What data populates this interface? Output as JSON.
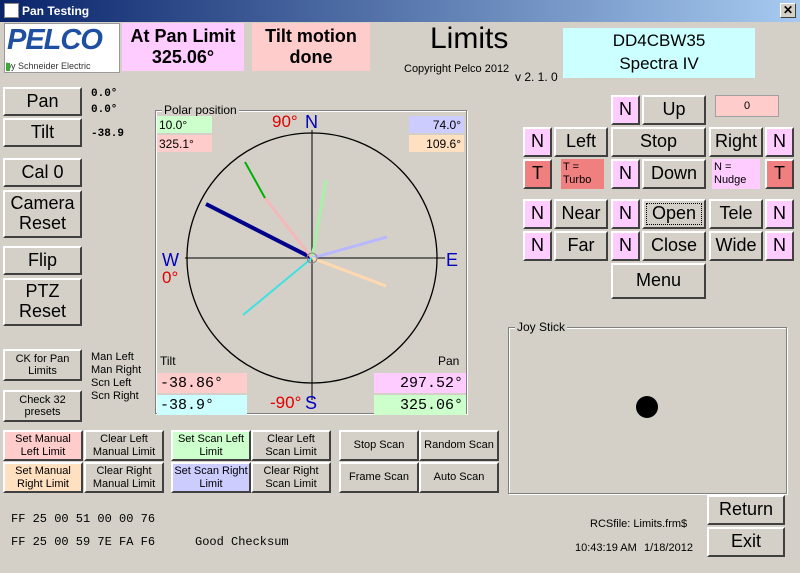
{
  "window": {
    "title": "Pan Testing",
    "close": "✕"
  },
  "logo": {
    "brand": "PELCO",
    "sub": "by Schneider Electric"
  },
  "status": {
    "pan_limit_label": "At Pan Limit",
    "pan_limit_value": "325.06°",
    "tilt_line1": "Tilt motion",
    "tilt_line2": "done"
  },
  "heading": {
    "title": "Limits",
    "copyright": "Copyright Pelco 2012",
    "version": "v 2. 1. 0"
  },
  "device": {
    "id": "DD4CBW35",
    "model": "Spectra IV"
  },
  "left_buttons": {
    "pan": "Pan",
    "tilt": "Tilt",
    "cal0": "Cal 0",
    "camera_reset": "Camera Reset",
    "flip": "Flip",
    "ptz_reset": "PTZ Reset",
    "ck_pan": "CK for Pan Limits",
    "check32": "Check 32 presets"
  },
  "readouts": {
    "pan1": "0.0°",
    "pan2": "0.0°",
    "tilt": "-38.9"
  },
  "limit_labels": [
    "Man Left",
    "Man Right",
    "Scn Left",
    "Scn Right"
  ],
  "polar": {
    "caption": "Polar position",
    "deg90": "90°",
    "N": "N",
    "E": "E",
    "W": "W",
    "S": "S",
    "deg0": "0°",
    "degm90": "-90°",
    "tl1": "10.0°",
    "tl2": "325.1°",
    "tr1": "74.0°",
    "tr2": "109.6°",
    "tilt_label": "Tilt",
    "pan_label": "Pan",
    "tilt1": "-38.86°",
    "tilt2": "-38.9°",
    "pan1": "297.52°",
    "pan2": "325.06°",
    "colors": {
      "green": "#ccffcc",
      "pink": "#ffcccc",
      "blue": "#ccccff",
      "peach": "#ffe0c0",
      "magenta": "#ffccff",
      "cyan": "#ccffff"
    }
  },
  "scan_buttons": {
    "set_manual_left": "Set Manual Left Limit",
    "clear_left_manual": "Clear Left Manual Limit",
    "set_scan_left": "Set Scan Left Limit",
    "clear_left_scan": "Clear Left Scan Limit",
    "stop_scan": "Stop Scan",
    "random_scan": "Random Scan",
    "set_manual_right": "Set Manual Right Limit",
    "clear_right_manual": "Clear Right Manual Limit",
    "set_scan_right": "Set Scan Right Limit",
    "clear_right_scan": "Clear Right Scan Limit",
    "frame_scan": "Frame Scan",
    "auto_scan": "Auto Scan"
  },
  "hex": {
    "line1": "FF 25 00 51 00 00 76",
    "line2": "FF 25 00 59 7E FA F6",
    "checksum": "Good Checksum"
  },
  "control": {
    "N": "N",
    "T": "T",
    "up": "Up",
    "left": "Left",
    "stop": "Stop",
    "right": "Right",
    "down": "Down",
    "near": "Near",
    "open": "Open",
    "tele": "Tele",
    "far": "Far",
    "close": "Close",
    "wide": "Wide",
    "menu": "Menu",
    "counter": "0",
    "turbo": "T = Turbo",
    "nudge": "N = Nudge"
  },
  "joystick": {
    "caption": "Joy Stick"
  },
  "footer": {
    "rcs": "RCSfile: Limits.frm$",
    "time": "10:43:19 AM",
    "date": "1/18/2012",
    "return": "Return",
    "exit": "Exit"
  }
}
